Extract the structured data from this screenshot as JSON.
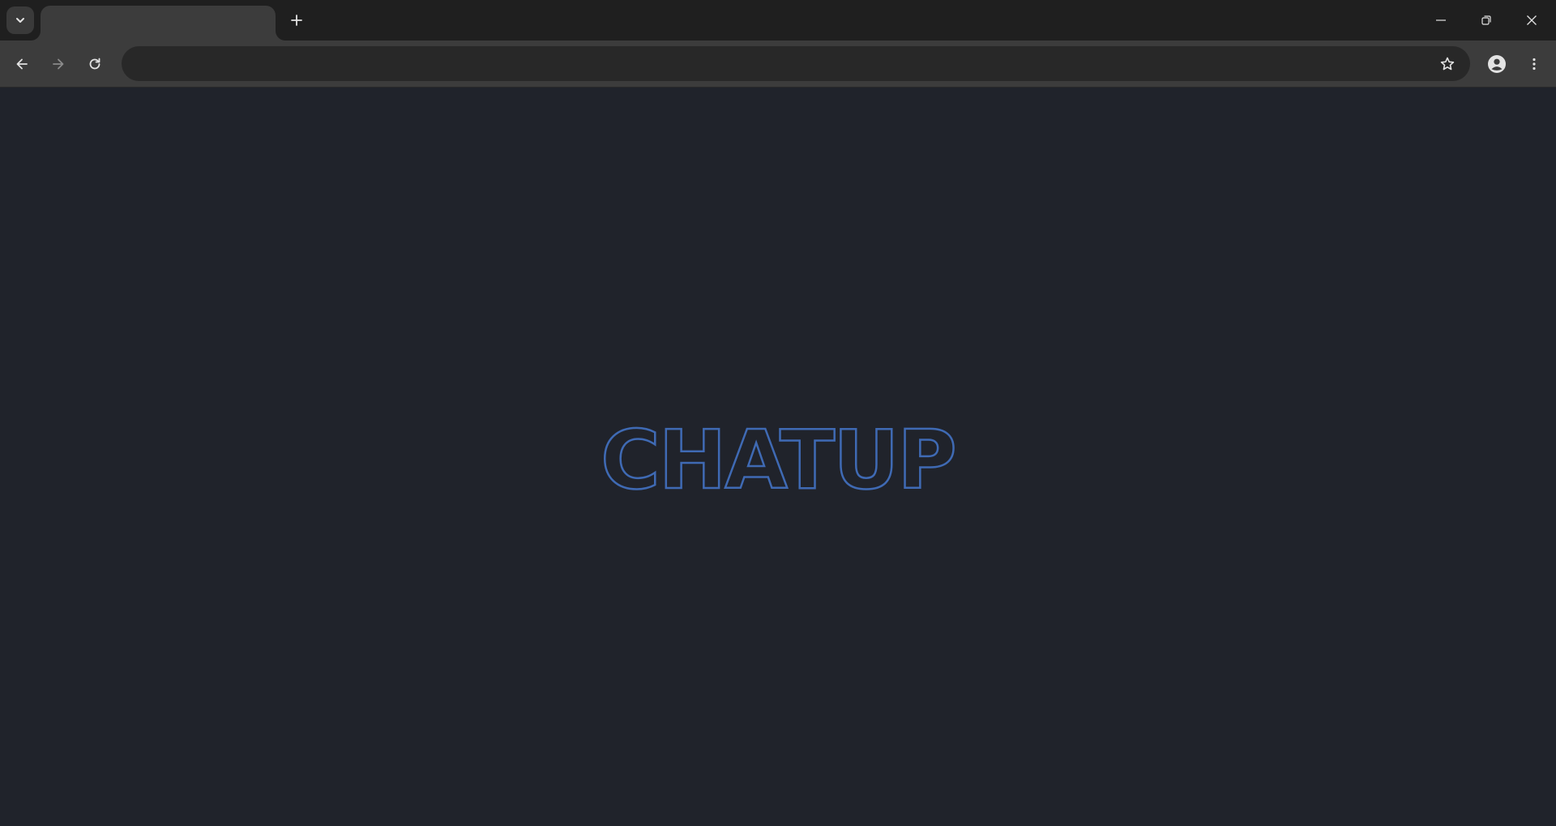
{
  "browser": {
    "tab": {
      "title": ""
    },
    "omnibox": {
      "value": "",
      "placeholder": ""
    },
    "icons": {
      "tab_search": "chevron-down-icon",
      "new_tab": "plus-icon",
      "minimize": "minimize-icon",
      "restore": "restore-icon",
      "close": "close-icon",
      "back": "arrow-left-icon",
      "forward": "arrow-right-icon",
      "reload": "reload-icon",
      "bookmark": "star-icon",
      "profile": "person-icon",
      "menu": "three-dots-vertical-icon"
    }
  },
  "page": {
    "logo_text": "CHATUP",
    "background_color": "#20232b",
    "logo_color": "#3f6ab4"
  }
}
